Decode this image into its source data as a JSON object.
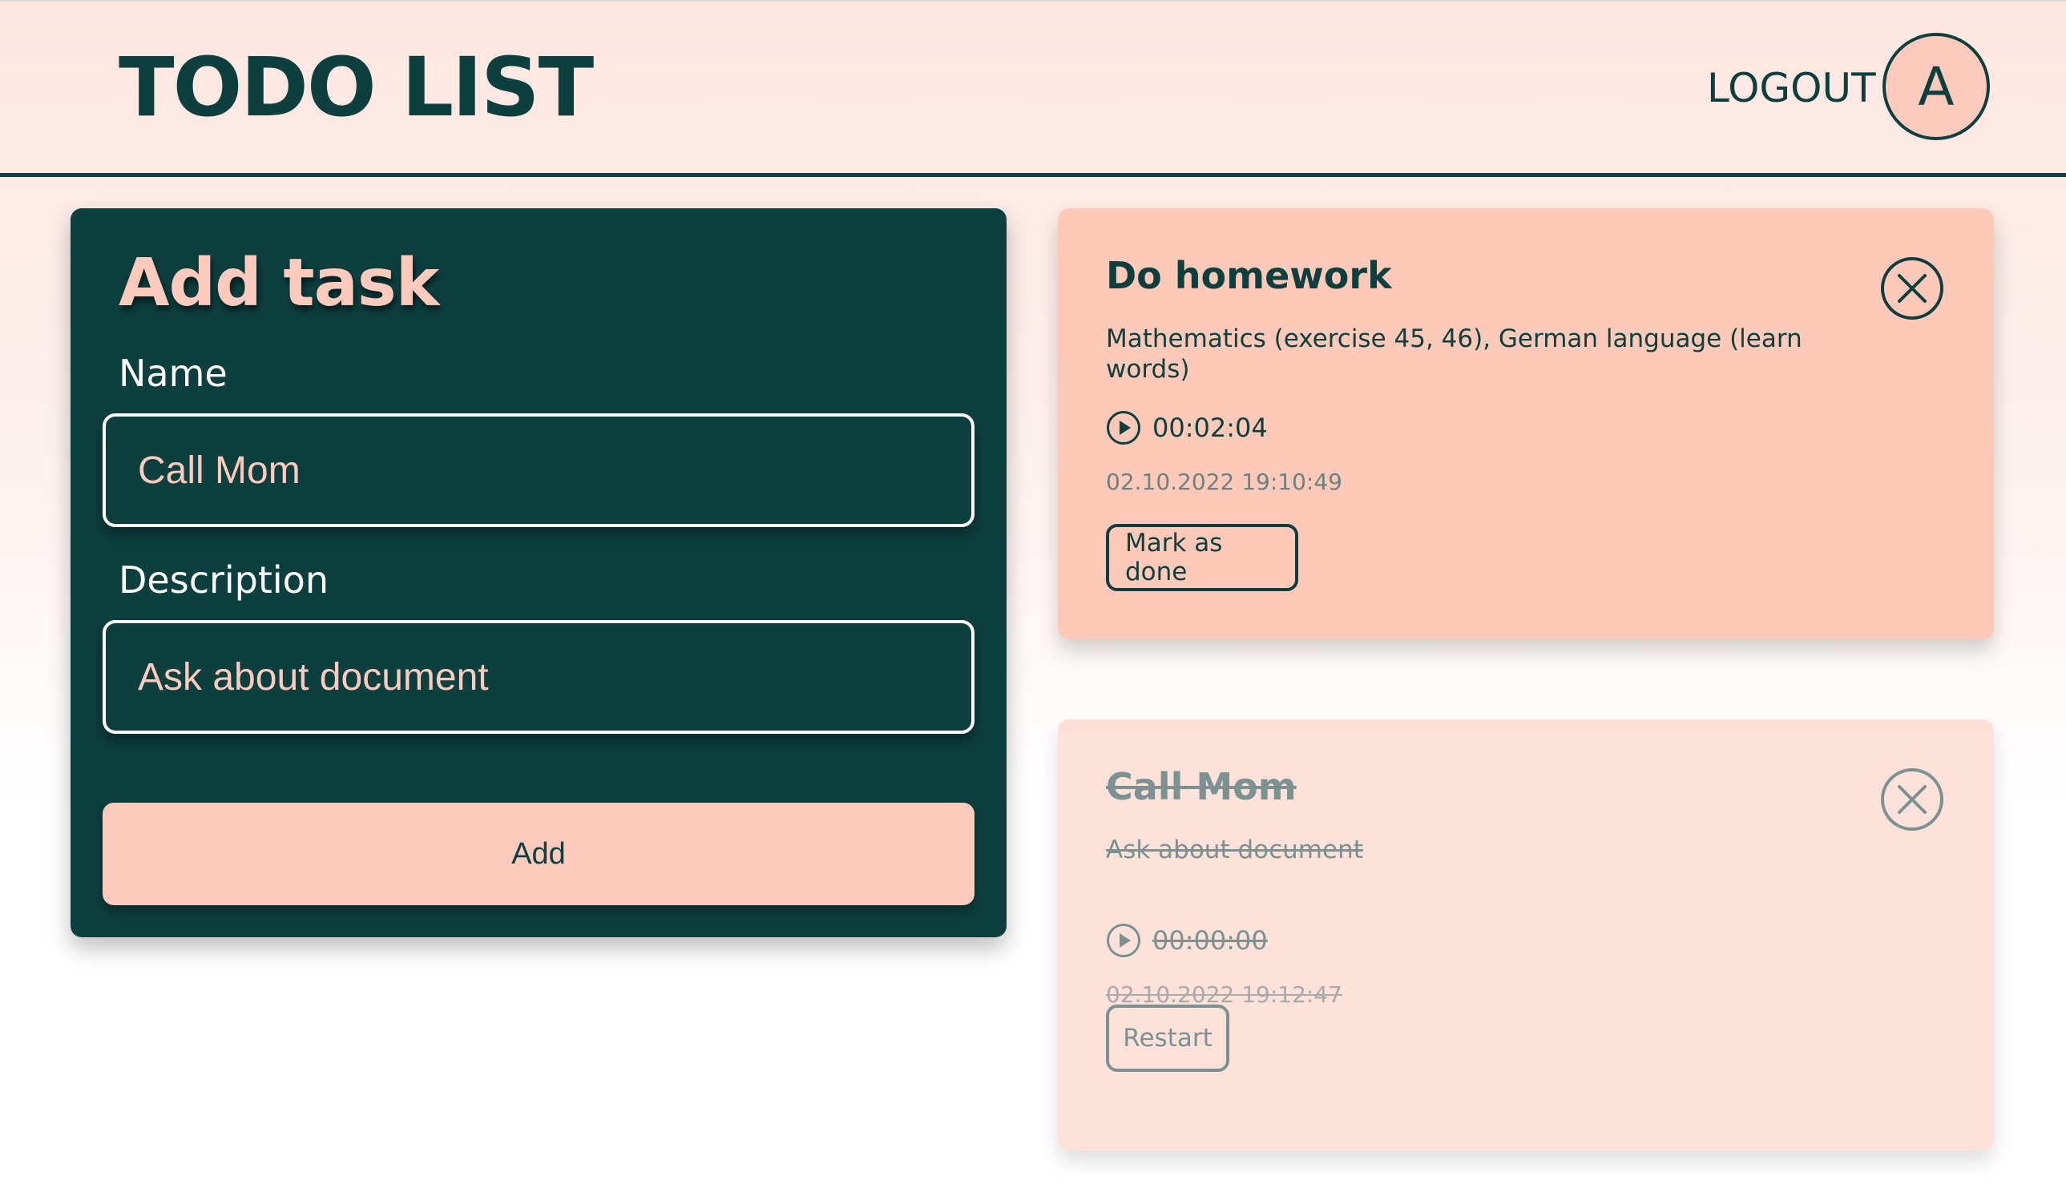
{
  "header": {
    "title": "TODO LIST",
    "logout_label": "LOGOUT",
    "avatar_initial": "A"
  },
  "add_task": {
    "title": "Add task",
    "name_label": "Name",
    "name_value": "Call Mom",
    "description_label": "Description",
    "description_value": "Ask about document",
    "add_button_label": "Add"
  },
  "tasks": [
    {
      "title": "Do homework",
      "description": "Mathematics (exercise 45, 46), German language (learn words)",
      "timer": "00:02:04",
      "created": "02.10.2022 19:10:49",
      "action_label": "Mark as done",
      "done": false
    },
    {
      "title": "Call Mom",
      "description": "Ask about document",
      "timer": "00:00:00",
      "created": "02.10.2022 19:12:47",
      "action_label": "Restart",
      "done": true
    }
  ],
  "colors": {
    "primary_dark": "#0d3f3f",
    "accent_peach": "#fccbbd",
    "card_active": "#fdc9b8",
    "card_done": "#fdd8cc"
  },
  "icons": {
    "close": "close-circle-x-icon",
    "play": "play-circle-icon"
  }
}
